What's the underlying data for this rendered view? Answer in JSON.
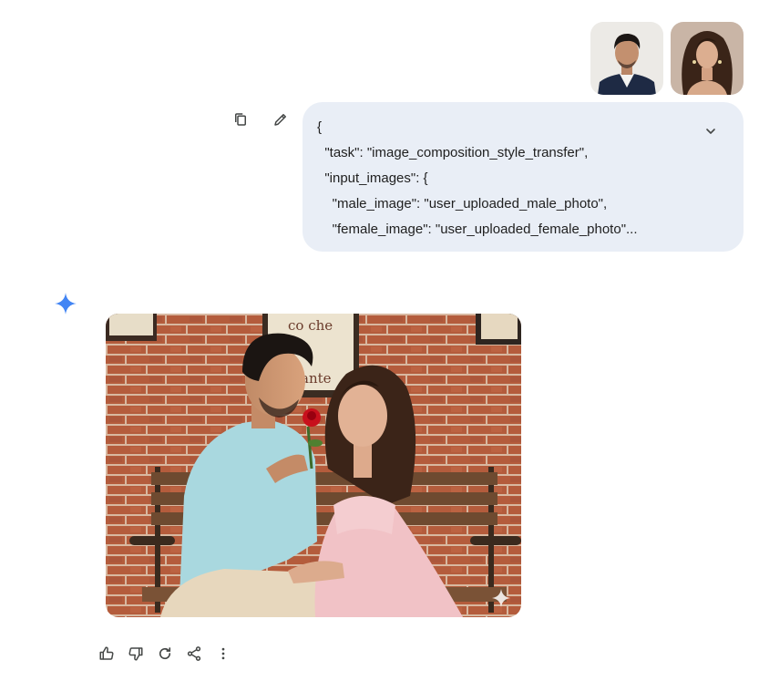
{
  "user_message": {
    "uploaded_images": [
      {
        "name": "male-photo-thumbnail"
      },
      {
        "name": "female-photo-thumbnail"
      }
    ],
    "prompt_lines": [
      "{",
      "  \"task\": \"image_composition_style_transfer\",",
      "  \"input_images\": {",
      "    \"male_image\": \"user_uploaded_male_photo\",",
      "    \"female_image\": \"user_uploaded_female_photo\"..."
    ],
    "actions": [
      "copy-icon",
      "edit-pencil-icon",
      "chevron-down-icon"
    ]
  },
  "response": {
    "icon": "gemini-spark-icon",
    "image": {
      "sign_text": "co che",
      "sign_text_2": "ante"
    },
    "actions": [
      "thumbs-up-icon",
      "thumbs-down-icon",
      "regenerate-icon",
      "share-icon",
      "more-vertical-icon"
    ]
  },
  "colors": {
    "bubble_bg": "#e9eef6",
    "icon_gray": "#444746",
    "spark_blue": "#4285f4"
  }
}
